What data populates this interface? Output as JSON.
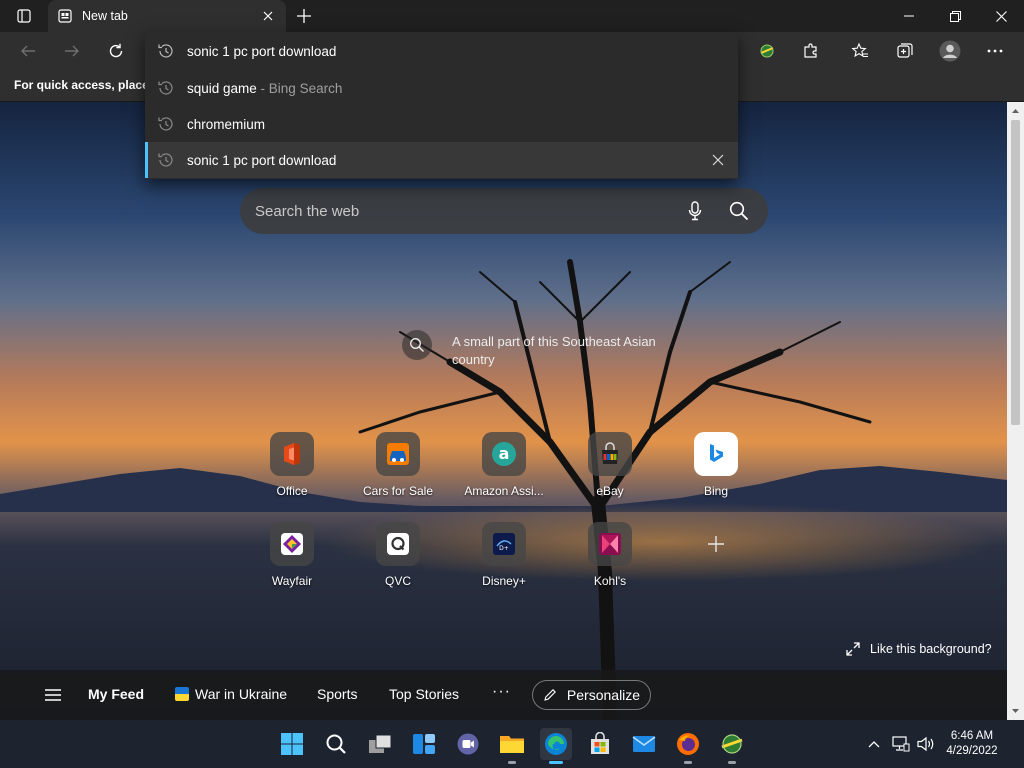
{
  "tab": {
    "title": "New tab"
  },
  "favorites_bar": {
    "text": "For quick access, place y"
  },
  "omnibox": {
    "value": "sonic 1 pc port download",
    "suggestions": [
      {
        "text": "squid game",
        "sub": " - Bing Search"
      },
      {
        "text": "chromemium",
        "sub": ""
      },
      {
        "text": "sonic 1 pc port download",
        "sub": ""
      }
    ]
  },
  "search": {
    "placeholder": "Search the web"
  },
  "background": {
    "caption": "A small part of this Southeast Asian country",
    "like_label": "Like this background?"
  },
  "quick_links": [
    {
      "label": "Office",
      "icon": "office-icon"
    },
    {
      "label": "Cars for Sale",
      "icon": "cars-icon"
    },
    {
      "label": "Amazon Assi...",
      "icon": "amazon-icon"
    },
    {
      "label": "eBay",
      "icon": "ebay-icon"
    },
    {
      "label": "Bing",
      "icon": "bing-icon"
    },
    {
      "label": "Wayfair",
      "icon": "wayfair-icon"
    },
    {
      "label": "QVC",
      "icon": "qvc-icon"
    },
    {
      "label": "Disney+",
      "icon": "disney-icon"
    },
    {
      "label": "Kohl's",
      "icon": "kohls-icon"
    }
  ],
  "feed": {
    "my_feed": "My Feed",
    "items": [
      "War in Ukraine",
      "Sports",
      "Top Stories"
    ],
    "more": "···",
    "personalize": "Personalize"
  },
  "clock": {
    "time": "6:46 AM",
    "date": "4/29/2022"
  },
  "colors": {
    "accent": "#4cc2ff",
    "toolbar": "#2f2f2f",
    "taskbar": "#1d2430"
  }
}
